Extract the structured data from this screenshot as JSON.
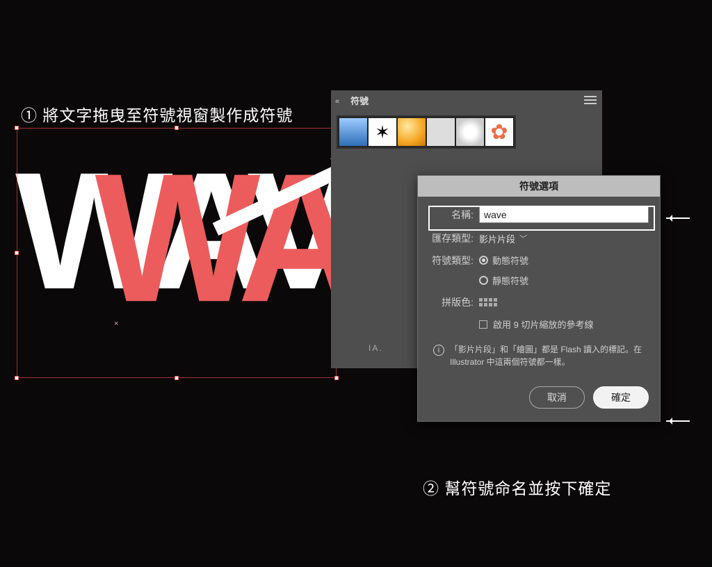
{
  "steps": {
    "one": "① 將文字拖曳至符號視窗製作成符號",
    "two": "② 幫符號命名並按下確定"
  },
  "canvas": {
    "text_white": "WAVE",
    "text_red": "WAVE"
  },
  "symbols_panel": {
    "title": "符號",
    "swatches": [
      "blue-gradient",
      "ink-splat",
      "orange-orb",
      "grid",
      "starburst",
      "flower"
    ]
  },
  "dialog": {
    "title": "符號選項",
    "name_label": "名稱:",
    "name_value": "wave",
    "export_type_label": "匯存類型:",
    "export_type_value": "影片片段",
    "symbol_type_label": "符號類型:",
    "radio_dynamic": "動態符號",
    "radio_static": "靜態符號",
    "registration_label": "拼版色:",
    "nine_slice": "啟用 9 切片縮放的參考線",
    "info": "「影片片段」和「繪圖」都是 Flash 讀入的標記。在 Illustrator 中這兩個符號都一樣。",
    "cancel": "取消",
    "ok": "確定"
  },
  "ai_mark": "IA."
}
